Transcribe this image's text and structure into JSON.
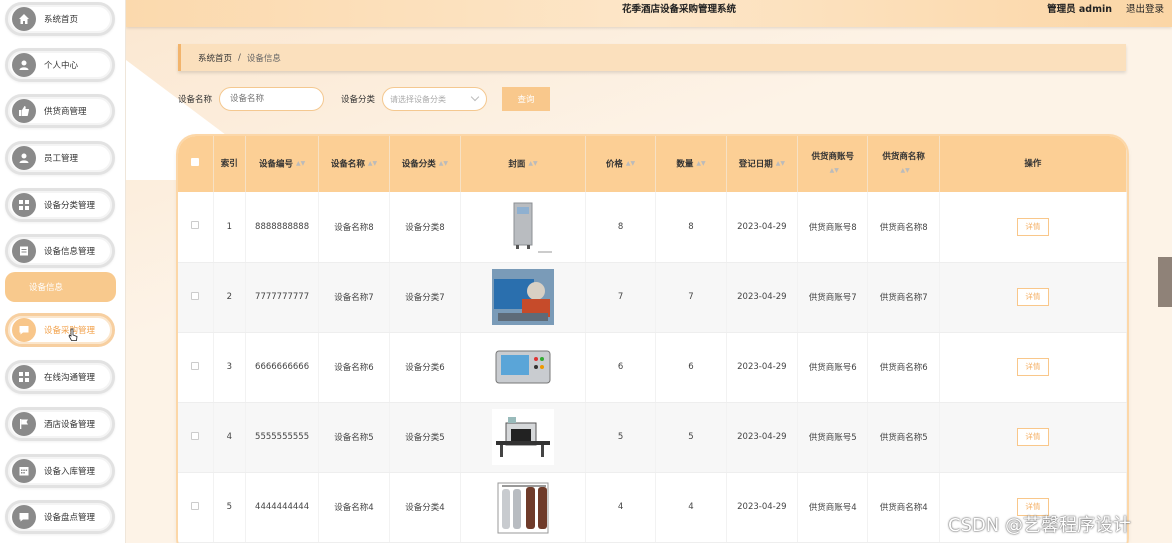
{
  "app": {
    "title": "花季酒店设备采购管理系统"
  },
  "header": {
    "user": "管理员 admin",
    "logout": "退出登录"
  },
  "sidebar": {
    "items": [
      {
        "label": "系统首页",
        "icon": "home-icon"
      },
      {
        "label": "个人中心",
        "icon": "user-icon"
      },
      {
        "label": "供货商管理",
        "icon": "thumb-icon"
      },
      {
        "label": "员工管理",
        "icon": "user-icon"
      },
      {
        "label": "设备分类管理",
        "icon": "grid-icon"
      },
      {
        "label": "设备信息管理",
        "icon": "doc-icon"
      },
      {
        "label": "设备采购管理",
        "icon": "chat-icon"
      },
      {
        "label": "在线沟通管理",
        "icon": "grid-icon"
      },
      {
        "label": "酒店设备管理",
        "icon": "flag-icon"
      },
      {
        "label": "设备入库管理",
        "icon": "calendar-icon"
      },
      {
        "label": "设备盘点管理",
        "icon": "chat-icon"
      }
    ],
    "sub_active": "设备信息"
  },
  "breadcrumb": {
    "home": "系统首页",
    "sep": "/",
    "current": "设备信息"
  },
  "search": {
    "name_label": "设备名称",
    "name_placeholder": "设备名称",
    "category_label": "设备分类",
    "category_placeholder": "请选择设备分类",
    "button": "查询"
  },
  "table": {
    "headers": {
      "index": "索引",
      "code": "设备编号",
      "name": "设备名称",
      "category": "设备分类",
      "cover": "封面",
      "price": "价格",
      "qty": "数量",
      "date": "登记日期",
      "supplier_acct": "供货商账号",
      "supplier_name": "供货商名称",
      "op": "操作"
    },
    "detail_label": "详情",
    "rows": [
      {
        "index": "1",
        "code": "8888888888",
        "name": "设备名称8",
        "category": "设备分类8",
        "price": "8",
        "qty": "8",
        "date": "2023-04-29",
        "supplier_acct": "供货商账号8",
        "supplier_name": "供货商名称8",
        "img": "cabinet"
      },
      {
        "index": "2",
        "code": "7777777777",
        "name": "设备名称7",
        "category": "设备分类7",
        "price": "7",
        "qty": "7",
        "date": "2023-04-29",
        "supplier_acct": "供货商账号7",
        "supplier_name": "供货商名称7",
        "img": "machine"
      },
      {
        "index": "3",
        "code": "6666666666",
        "name": "设备名称6",
        "category": "设备分类6",
        "price": "6",
        "qty": "6",
        "date": "2023-04-29",
        "supplier_acct": "供货商账号6",
        "supplier_name": "供货商名称6",
        "img": "panel"
      },
      {
        "index": "4",
        "code": "5555555555",
        "name": "设备名称5",
        "category": "设备分类5",
        "price": "5",
        "qty": "5",
        "date": "2023-04-29",
        "supplier_acct": "供货商账号5",
        "supplier_name": "供货商名称5",
        "img": "xray"
      },
      {
        "index": "5",
        "code": "4444444444",
        "name": "设备名称4",
        "category": "设备分类4",
        "price": "4",
        "qty": "4",
        "date": "2023-04-29",
        "supplier_acct": "供货商账号4",
        "supplier_name": "供货商名称4",
        "img": "tanks"
      }
    ]
  },
  "watermark": "CSDN @艺馨程序设计",
  "colors": {
    "accent": "#f9c88c",
    "header_row": "#fccf95",
    "breadcrumb_bg": "#fbe0bd"
  }
}
